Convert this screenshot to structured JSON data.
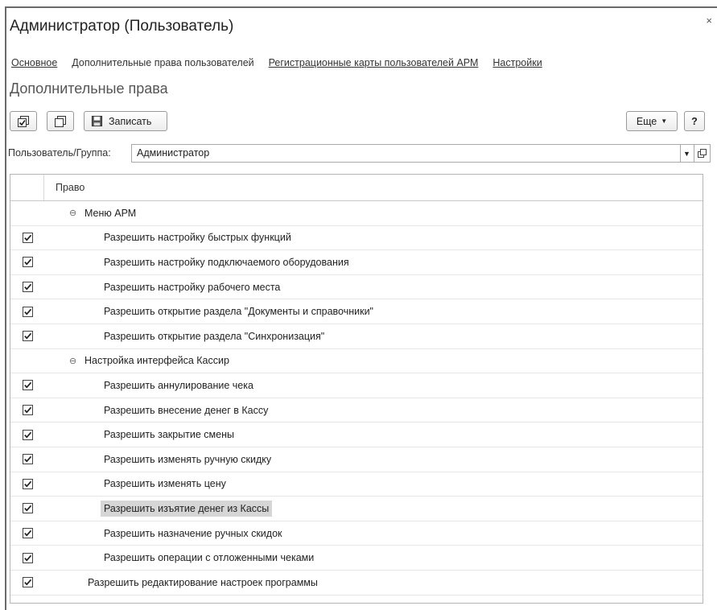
{
  "window": {
    "title": "Администратор (Пользователь)",
    "close_glyph": "×"
  },
  "tabs": [
    {
      "label": "Основное",
      "active": false
    },
    {
      "label": "Дополнительные права пользователей",
      "active": true
    },
    {
      "label": "Регистрационные карты пользователей АРМ",
      "active": false
    },
    {
      "label": "Настройки",
      "active": false
    }
  ],
  "section_title": "Дополнительные права",
  "toolbar": {
    "save_label": "Записать",
    "more_label": "Еще",
    "help_label": "?",
    "icons": [
      "check-all-icon",
      "uncheck-all-icon",
      "floppy-disk-icon"
    ]
  },
  "user": {
    "label": "Пользователь/Группа:",
    "value": "Администратор"
  },
  "grid": {
    "column_header": "Право",
    "rows": [
      {
        "type": "group",
        "label": "Меню АРМ"
      },
      {
        "type": "item",
        "level": 1,
        "checked": true,
        "label": "Разрешить настройку быстрых функций"
      },
      {
        "type": "item",
        "level": 1,
        "checked": true,
        "label": "Разрешить настройку подключаемого оборудования"
      },
      {
        "type": "item",
        "level": 1,
        "checked": true,
        "label": "Разрешить настройку рабочего места"
      },
      {
        "type": "item",
        "level": 1,
        "checked": true,
        "label": "Разрешить открытие раздела \"Документы и справочники\""
      },
      {
        "type": "item",
        "level": 1,
        "checked": true,
        "label": "Разрешить открытие раздела \"Синхронизация\""
      },
      {
        "type": "group",
        "label": "Настройка интерфейса Кассир"
      },
      {
        "type": "item",
        "level": 1,
        "checked": true,
        "label": "Разрешить аннулирование чека"
      },
      {
        "type": "item",
        "level": 1,
        "checked": true,
        "label": "Разрешить внесение денег в Кассу"
      },
      {
        "type": "item",
        "level": 1,
        "checked": true,
        "label": "Разрешить закрытие смены"
      },
      {
        "type": "item",
        "level": 1,
        "checked": true,
        "label": "Разрешить изменять ручную скидку"
      },
      {
        "type": "item",
        "level": 1,
        "checked": true,
        "label": "Разрешить изменять цену"
      },
      {
        "type": "item",
        "level": 1,
        "checked": true,
        "selected": true,
        "label": "Разрешить изъятие денег из Кассы"
      },
      {
        "type": "item",
        "level": 1,
        "checked": true,
        "label": "Разрешить назначение ручных скидок"
      },
      {
        "type": "item",
        "level": 1,
        "checked": true,
        "label": "Разрешить операции с отложенными чеками"
      },
      {
        "type": "item",
        "level": 0,
        "checked": true,
        "label": "Разрешить редактирование настроек программы"
      }
    ]
  }
}
